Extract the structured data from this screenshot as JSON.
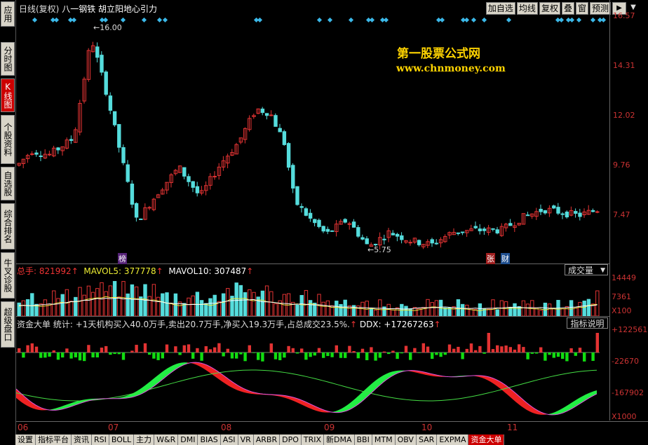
{
  "sidebar": {
    "items": [
      {
        "label": "应用",
        "active": false
      },
      {
        "label": "分时图",
        "active": false
      },
      {
        "label": "K线图",
        "active": true
      },
      {
        "label": "个股资料",
        "active": false
      },
      {
        "label": "自选股",
        "active": false
      },
      {
        "label": "综合排名",
        "active": false
      },
      {
        "label": "牛叉诊股",
        "active": false
      },
      {
        "label": "超级盘口",
        "active": false
      }
    ]
  },
  "header": {
    "period": "日线(复权)",
    "stock_name": "八一钢铁",
    "indicator_name": "胡立阳地心引力",
    "buttons": [
      "加自选",
      "均线",
      "复权",
      "叠",
      "窗",
      "预测"
    ],
    "play_icon": "▶",
    "menu_icon": "▼"
  },
  "watermark": {
    "name": "第一股票公式网",
    "url": "www.chnmoney.com"
  },
  "price_panel": {
    "y_labels": [
      "16.57",
      "14.31",
      "12.02",
      "9.76",
      "7.47"
    ],
    "high_marker": "16.00",
    "low_marker": "5.75",
    "event_markers": [
      "榜",
      "张",
      "财"
    ]
  },
  "volume_panel": {
    "label_name": "总手:",
    "label_value": "821992",
    "mavol5_name": "MAVOL5:",
    "mavol5_value": "377778",
    "mavol10_name": "MAVOL10:",
    "mavol10_value": "307487",
    "up_arrow": "↑",
    "selector": "成交量",
    "y_labels": [
      "14449",
      "7361",
      "X100"
    ]
  },
  "fund_panel": {
    "title": "资金大单",
    "summary": "统计: +1天机构买入40.0万手,卖出20.7万手,净买入19.3万手,占总成交23.5%.",
    "ddx_label": "DDX:",
    "ddx_value": "+17267263",
    "up_arrow": "↑",
    "explain_button": "指标说明",
    "y_labels": [
      "+122561",
      "-22670",
      "-167902",
      "X1000"
    ]
  },
  "x_axis": {
    "labels": [
      "06",
      "07",
      "08",
      "09",
      "10",
      "11"
    ]
  },
  "tabs": [
    "设置",
    "指标平台",
    "资讯",
    "RSI",
    "BOLL",
    "主力",
    "W&R",
    "DMI",
    "BIAS",
    "ASI",
    "VR",
    "ARBR",
    "DPO",
    "TRIX",
    "新DMA",
    "BBI",
    "MTM",
    "OBV",
    "SAR",
    "EXPMA",
    "资金大单"
  ],
  "active_tab": "资金大单",
  "colors": {
    "up": "#e33333",
    "down": "#55dddd",
    "accent_red": "#cc0000",
    "watermark": "#ffd400",
    "diamond": "#3bb8e8"
  }
}
